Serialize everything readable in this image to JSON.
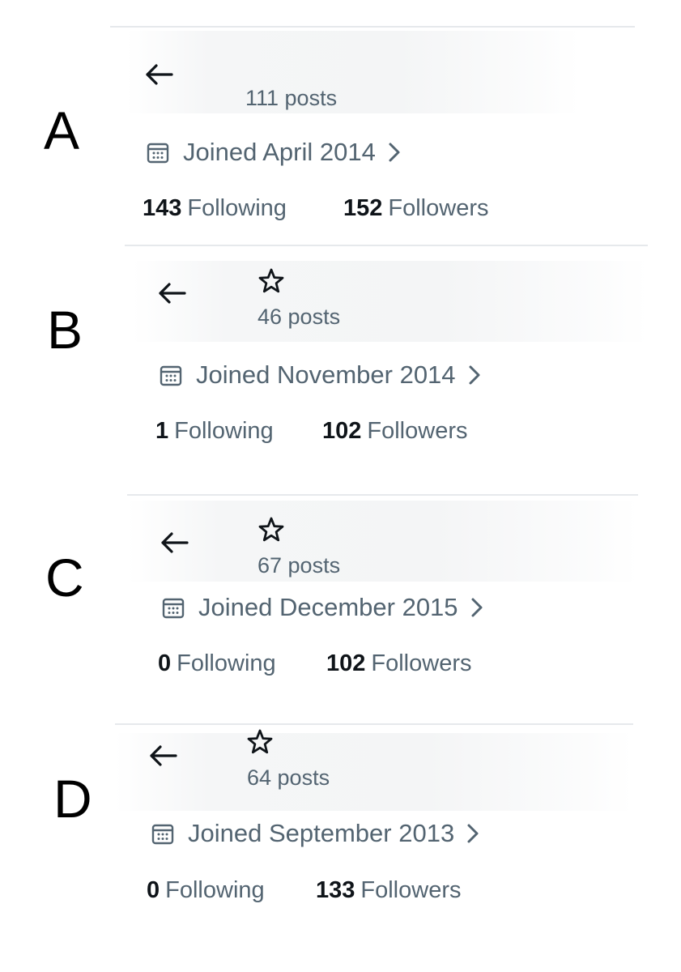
{
  "colors": {
    "primary_text": "#0f1419",
    "secondary_text": "#536471",
    "divider": "#e6e9ec",
    "background": "#ffffff"
  },
  "icons": {
    "back": "arrow-left-icon",
    "star": "star-icon",
    "calendar": "calendar-icon",
    "chevron": "chevron-right-icon"
  },
  "panels": [
    {
      "letter": "A",
      "posts": "111 posts",
      "joined": "Joined April 2014",
      "following_count": "143",
      "following_label": "Following",
      "followers_count": "152",
      "followers_label": "Followers"
    },
    {
      "letter": "B",
      "posts": "46 posts",
      "joined": "Joined November 2014",
      "following_count": "1",
      "following_label": "Following",
      "followers_count": "102",
      "followers_label": "Followers"
    },
    {
      "letter": "C",
      "posts": "67 posts",
      "joined": "Joined December 2015",
      "following_count": "0",
      "following_label": "Following",
      "followers_count": "102",
      "followers_label": "Followers"
    },
    {
      "letter": "D",
      "posts": "64 posts",
      "joined": "Joined September 2013",
      "following_count": "0",
      "following_label": "Following",
      "followers_count": "133",
      "followers_label": "Followers"
    }
  ]
}
